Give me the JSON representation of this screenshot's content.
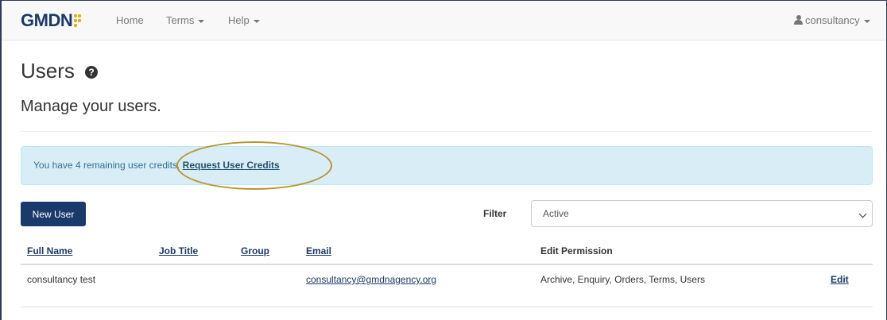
{
  "navbar": {
    "brand": "GMDN",
    "home": "Home",
    "terms": "Terms",
    "help": "Help",
    "user": "consultancy"
  },
  "page": {
    "title": "Users",
    "subtitle": "Manage your users."
  },
  "alert": {
    "text": "You have 4 remaining user credits. ",
    "link": "Request User Credits"
  },
  "toolbar": {
    "new_user": "New User",
    "filter_label": "Filter",
    "filter_value": "Active"
  },
  "table": {
    "headers": {
      "full_name": "Full Name",
      "job_title": "Job Title",
      "group": "Group",
      "email": "Email",
      "edit_permission": "Edit Permission"
    },
    "rows": [
      {
        "full_name": "consultancy test",
        "job_title": "",
        "group": "",
        "email": "consultancy@gmdnagency.org",
        "edit_permission": "Archive, Enquiry, Orders, Terms, Users",
        "action": "Edit"
      }
    ]
  },
  "colors": {
    "brand": "#1a3a6b",
    "accent": "#e2b021",
    "alert_bg": "#d9edf7",
    "annotation": "#b8962e"
  }
}
